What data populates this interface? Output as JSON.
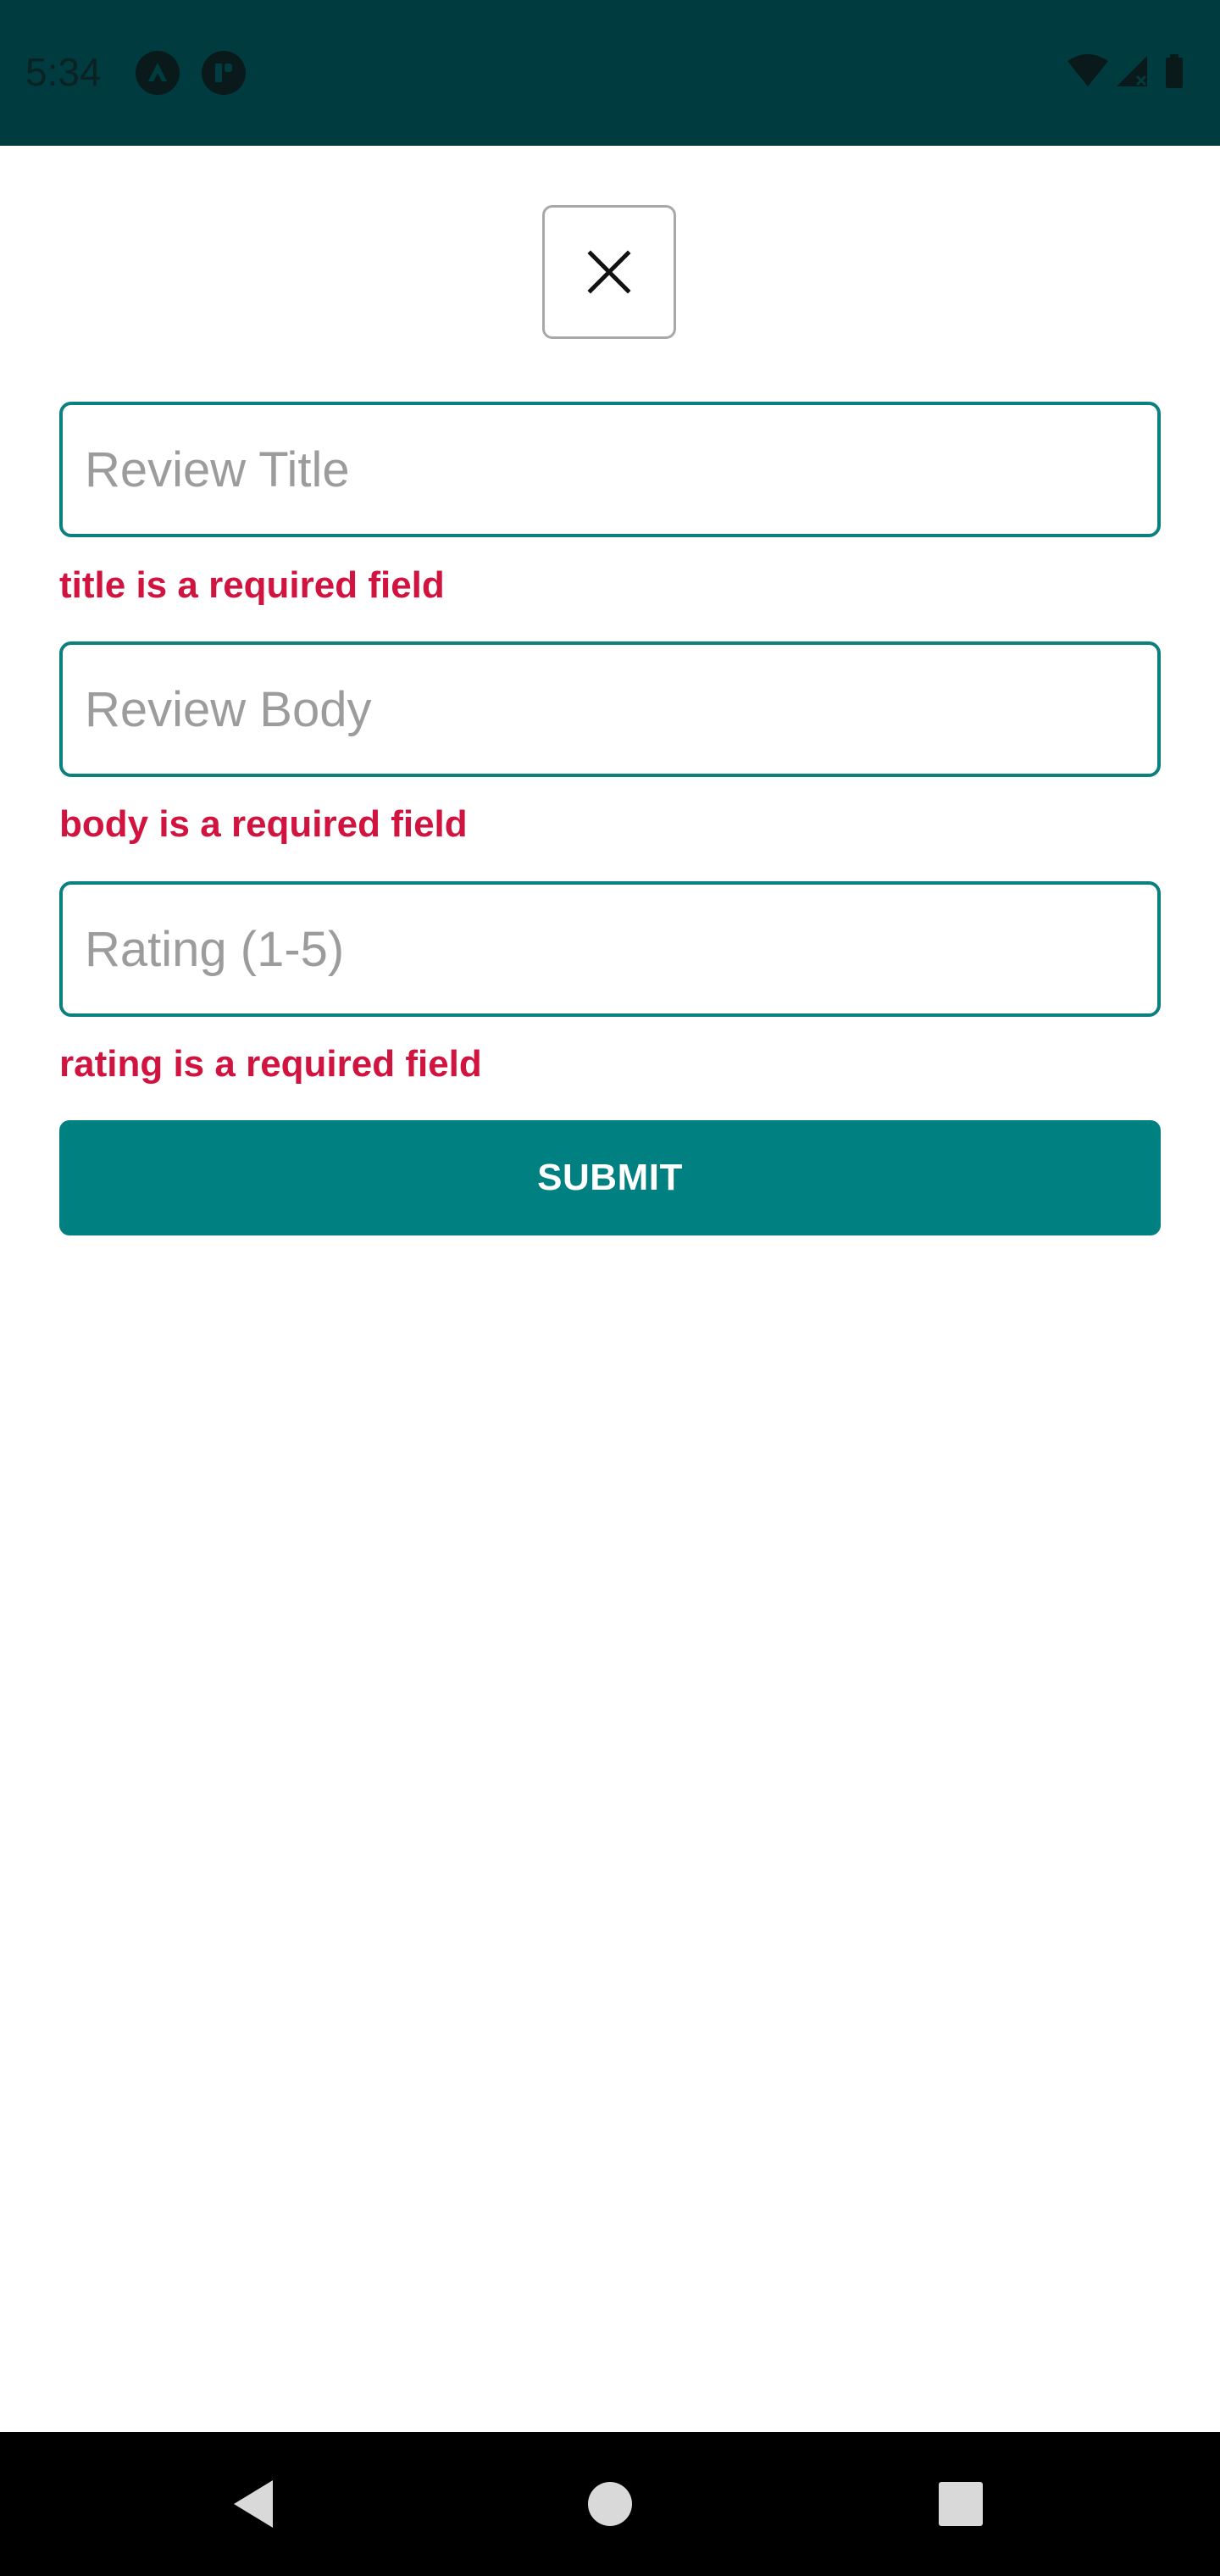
{
  "status_bar": {
    "time": "5:34",
    "background": "#003c3f",
    "icons": [
      "expo-app-icon",
      "notification-app-icon",
      "wifi-icon",
      "cellular-signal-icon",
      "battery-icon"
    ]
  },
  "dialog": {
    "close_icon": "close-icon"
  },
  "form": {
    "title_field": {
      "placeholder": "Review Title",
      "value": ""
    },
    "title_error": "title is a required field",
    "body_field": {
      "placeholder": "Review Body",
      "value": ""
    },
    "body_error": "body is a required field",
    "rating_field": {
      "placeholder": "Rating (1-5)",
      "value": ""
    },
    "rating_error": "rating is a required field",
    "submit_label": "SUBMIT"
  },
  "colors": {
    "accent": "#008080",
    "field_border": "#0c7f7f",
    "error": "#d0143f",
    "status_bar": "#003c3f",
    "nav_bar": "#000000"
  },
  "nav_bar": {
    "icons": [
      "back-icon",
      "home-icon",
      "recents-icon"
    ]
  }
}
